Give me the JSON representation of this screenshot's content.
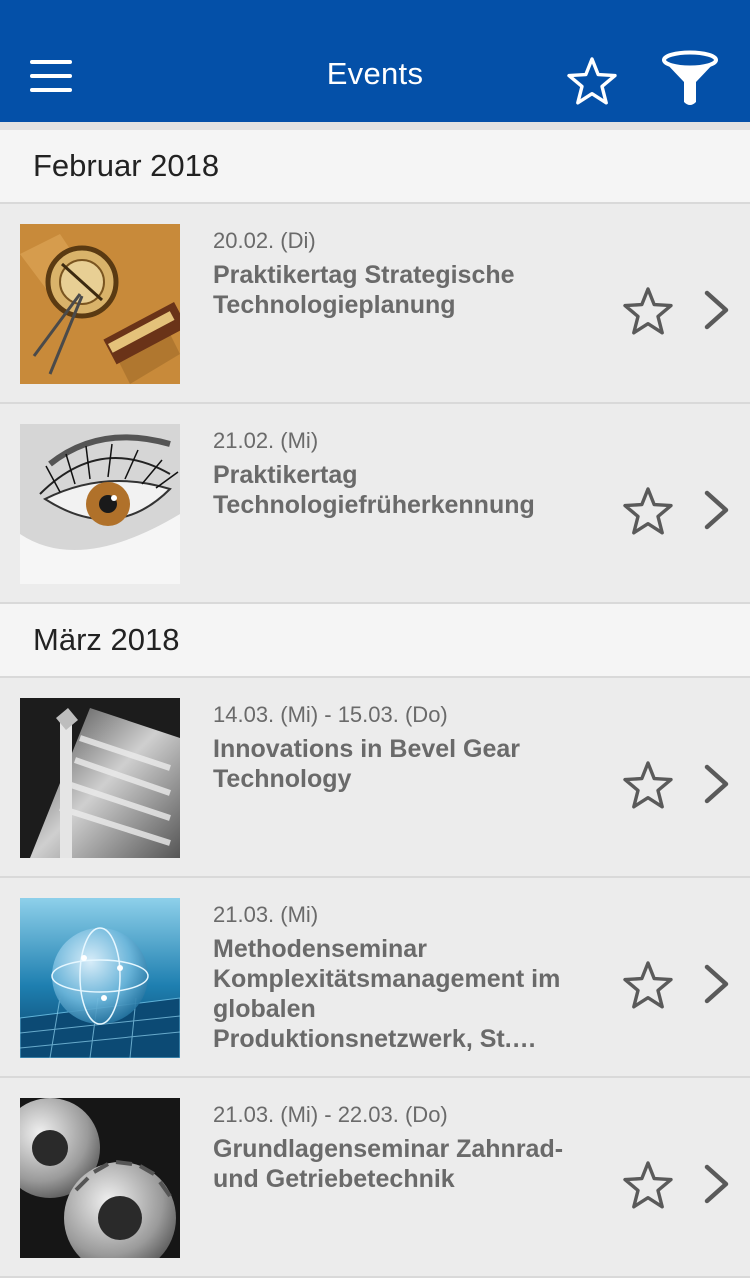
{
  "header": {
    "title": "Events",
    "menu_icon": "menu-icon",
    "favorites_icon": "star-icon",
    "filter_icon": "filter-icon"
  },
  "sections": [
    {
      "label": "Februar 2018",
      "events": [
        {
          "date": "20.02. (Di)",
          "title": "Praktikertag Strategische Technologieplanung",
          "image": "compass-map-image"
        },
        {
          "date": "21.02. (Mi)",
          "title": "Praktikertag Technologiefrüherkennung",
          "image": "eye-image"
        }
      ]
    },
    {
      "label": "März 2018",
      "events": [
        {
          "date": "14.03. (Mi) - 15.03. (Do)",
          "title": "Innovations in Bevel Gear Technology",
          "image": "bevel-gear-image"
        },
        {
          "date": "21.03. (Mi)",
          "title": "Methodenseminar Komplexitätsmanagement im globalen Produktionsnetzwerk, St.…",
          "image": "glass-globe-image"
        },
        {
          "date": "21.03. (Mi) - 22.03. (Do)",
          "title": "Grundlagenseminar Zahnrad- und Getriebetechnik",
          "image": "gears-image"
        }
      ]
    }
  ],
  "colors": {
    "app_bar": "#0450a8",
    "background": "#ececec",
    "section_background": "#f5f5f5",
    "text_muted": "#6a6a6a"
  }
}
